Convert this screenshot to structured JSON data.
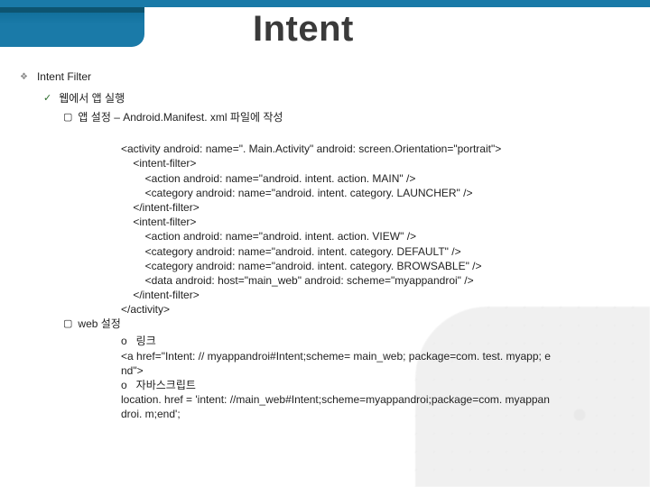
{
  "header": {
    "title": "Intent"
  },
  "bullets": {
    "lvl1": "Intent Filter",
    "lvl2": "웹에서 앱 실행",
    "app_setting_label": "앱 설정 – Android.Manifest. xml 파일에 작성",
    "web_setting_label": "web 설정"
  },
  "code": {
    "activity_open": "<activity android: name=\". Main.Activity\" android: screen.Orientation=\"portrait\">",
    "if1_open": "    <intent-filter>",
    "if1_action": "        <action android: name=\"android. intent. action. MAIN\" />",
    "if1_category": "        <category android: name=\"android. intent. category. LAUNCHER\" />",
    "if1_close": "    </intent-filter>",
    "if2_open": "    <intent-filter>",
    "if2_action": "        <action android: name=\"android. intent. action. VIEW\" />",
    "if2_cat1": "        <category android: name=\"android. intent. category. DEFAULT\" />",
    "if2_cat2": "        <category android: name=\"android. intent. category. BROWSABLE\" />",
    "if2_data": "        <data android: host=\"main_web\" android: scheme=\"myappandroi\" />",
    "if2_close": "    </intent-filter>",
    "activity_close": "</activity>"
  },
  "web": {
    "link_label": "o   링크",
    "link_code": "<a href=\"Intent: // myappandroi#Intent;scheme= main_web; package=com. test. myapp; end\">",
    "js_label": "o   자바스크립트",
    "js_code": "location. href = 'intent: //main_web#Intent;scheme=myappandroi;package=com. myappandroi. m;end';"
  }
}
